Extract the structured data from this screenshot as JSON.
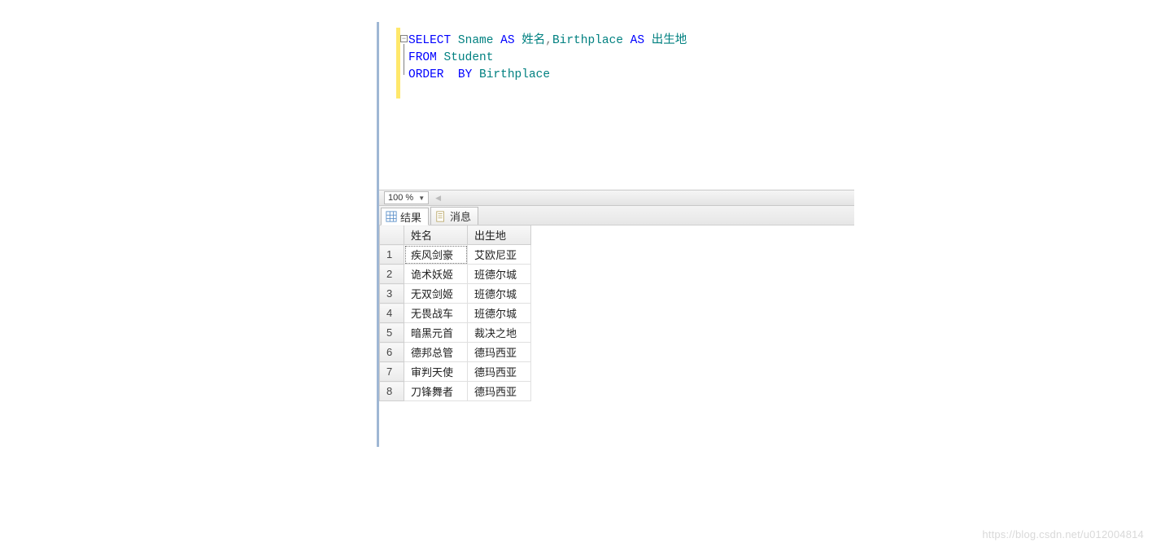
{
  "editor": {
    "line1": {
      "p1": "SELECT",
      "p2": " Sname ",
      "p3": "AS",
      "p4": " 姓名",
      "p5": ",",
      "p6": "Birthplace ",
      "p7": "AS",
      "p8": " 出生地"
    },
    "line2": {
      "p1": "FROM",
      "p2": " Student"
    },
    "line3": {
      "p1": "ORDER  BY",
      "p2": " Birthplace"
    },
    "fold": "−"
  },
  "zoom": {
    "value": "100 %"
  },
  "tabs": {
    "results": "结果",
    "messages": "消息"
  },
  "columns": {
    "c0": "",
    "c1": "姓名",
    "c2": "出生地"
  },
  "rows": [
    {
      "n": "1",
      "name": "疾风剑豪",
      "place": "艾欧尼亚"
    },
    {
      "n": "2",
      "name": "诡术妖姬",
      "place": "班德尔城"
    },
    {
      "n": "3",
      "name": "无双剑姬",
      "place": "班德尔城"
    },
    {
      "n": "4",
      "name": "无畏战车",
      "place": "班德尔城"
    },
    {
      "n": "5",
      "name": "暗黑元首",
      "place": "裁决之地"
    },
    {
      "n": "6",
      "name": "德邦总管",
      "place": "德玛西亚"
    },
    {
      "n": "7",
      "name": "审判天使",
      "place": "德玛西亚"
    },
    {
      "n": "8",
      "name": "刀锋舞者",
      "place": "德玛西亚"
    }
  ],
  "watermark": "https://blog.csdn.net/u012004814"
}
